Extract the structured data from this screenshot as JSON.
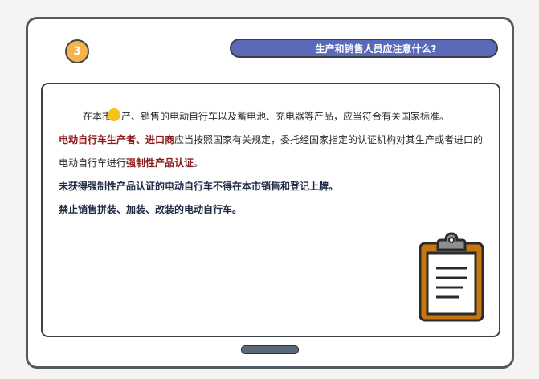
{
  "header": {
    "step_number": "3",
    "title": "生产和销售人员应注意什么?"
  },
  "content": {
    "p1": "在本市生产、销售的电动自行车以及蓄电池、充电器等产品，应当符合有关国家标准。",
    "p2_bold": "电动自行车生产者、进口商",
    "p2_mid": "应当按照国家有关规定，委托经国家指定的认证机构对其生产或者进口的电动自行车进行",
    "p2_bold_end": "强制性产品认证",
    "p2_end": "。",
    "p3": "未获得强制性产品认证的电动自行车不得在本市销售和登记上牌。",
    "p4": "禁止销售拼装、加装、改装的电动自行车。"
  },
  "icons": {
    "clipboard": "clipboard-icon",
    "cursor": "cursor-dot"
  },
  "colors": {
    "badge": "#f6b34a",
    "title_pill": "#5a6ab8",
    "highlight_red": "#8b1a1a",
    "clipboard_wood": "#c8750e"
  }
}
